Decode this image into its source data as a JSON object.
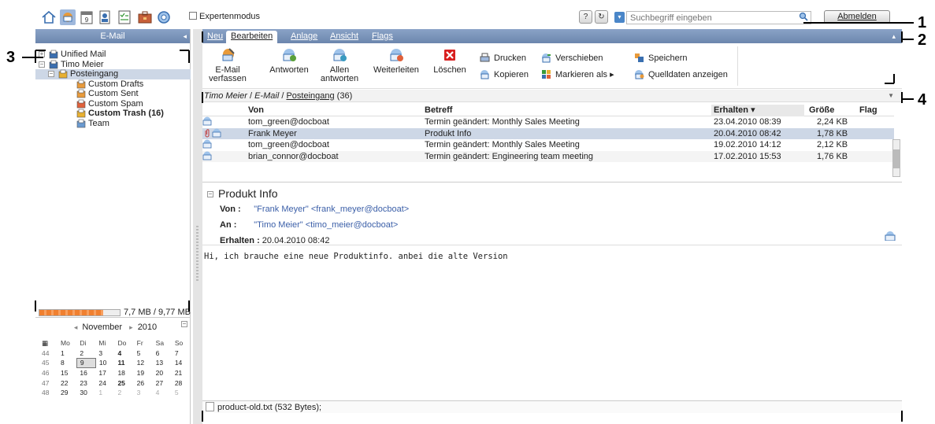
{
  "toolbar": {
    "apps": [
      "home-icon",
      "mail-icon",
      "calendar-icon",
      "contacts-icon",
      "tasks-icon",
      "infostore-icon",
      "settings-icon"
    ],
    "expert_mode_label": "Expertenmodus",
    "help_label": "?",
    "refresh_label": "↻",
    "search_placeholder": "Suchbegriff eingeben",
    "logout_label": "Abmelden"
  },
  "left_panel": {
    "title": "E-Mail",
    "tree": [
      {
        "label": "Unified Mail",
        "level": 0,
        "expander": "+",
        "icon": "unified-mail-icon"
      },
      {
        "label": "Timo Meier",
        "level": 0,
        "expander": "−",
        "icon": "account-icon"
      },
      {
        "label": "Posteingang",
        "level": 1,
        "expander": "−",
        "icon": "inbox-icon",
        "selected": true
      },
      {
        "label": "Custom Drafts",
        "level": 2,
        "expander": "",
        "icon": "drafts-icon"
      },
      {
        "label": "Custom Sent",
        "level": 2,
        "expander": "",
        "icon": "sent-icon"
      },
      {
        "label": "Custom Spam",
        "level": 2,
        "expander": "",
        "icon": "spam-icon"
      },
      {
        "label": "Custom Trash (16)",
        "level": 2,
        "expander": "",
        "icon": "trash-icon",
        "bold": true
      },
      {
        "label": "Team",
        "level": 2,
        "expander": "",
        "icon": "folder-icon"
      }
    ],
    "quota": {
      "text": "7,7 MB / 9,77 MB",
      "fraction": 0.79
    }
  },
  "calendar": {
    "month": "November",
    "year": "2010",
    "prev": "◂",
    "next": "▸",
    "headers": [
      "Mo",
      "Di",
      "Mi",
      "Do",
      "Fr",
      "Sa",
      "So"
    ],
    "weeks": [
      {
        "wk": "44",
        "days": [
          "1",
          "2",
          "3",
          "4",
          "5",
          "6",
          "7"
        ]
      },
      {
        "wk": "45",
        "days": [
          "8",
          "9",
          "10",
          "11",
          "12",
          "13",
          "14"
        ]
      },
      {
        "wk": "46",
        "days": [
          "15",
          "16",
          "17",
          "18",
          "19",
          "20",
          "21"
        ]
      },
      {
        "wk": "47",
        "days": [
          "22",
          "23",
          "24",
          "25",
          "26",
          "27",
          "28"
        ]
      },
      {
        "wk": "48",
        "days": [
          "29",
          "30",
          "1",
          "2",
          "3",
          "4",
          "5"
        ]
      }
    ],
    "current_day": "9"
  },
  "tabs": [
    {
      "label": "Neu",
      "active": false
    },
    {
      "label": "Bearbeiten",
      "active": true
    },
    {
      "label": "Anlage",
      "active": false
    },
    {
      "label": "Ansicht",
      "active": false
    },
    {
      "label": "Flags",
      "active": false
    }
  ],
  "ribbon": {
    "compose": "E-Mail verfassen",
    "reply": "Antworten",
    "reply_all": "Allen antworten",
    "forward": "Weiterleiten",
    "delete": "Löschen",
    "print": "Drucken",
    "copy": "Kopieren",
    "move": "Verschieben",
    "mark_as": "Markieren als ▸",
    "save": "Speichern",
    "show_source": "Quelldaten anzeigen"
  },
  "breadcrumb": {
    "user": "Timo Meier",
    "section": "E-Mail",
    "folder": "Posteingang",
    "count": "(36)"
  },
  "mail_table": {
    "columns": {
      "from": "Von",
      "subject": "Betreff",
      "received": "Erhalten ▾",
      "size": "Größe",
      "flag": "Flag"
    },
    "rows": [
      {
        "from": "tom_green@docboat",
        "subject": "Termin geändert: Monthly Sales Meeting",
        "received": "23.04.2010 08:39",
        "size": "2,24 KB",
        "attach": false,
        "selected": false
      },
      {
        "from": "Frank Meyer",
        "subject": "Produkt Info",
        "received": "20.04.2010 08:42",
        "size": "1,78 KB",
        "attach": true,
        "selected": true
      },
      {
        "from": "tom_green@docboat",
        "subject": "Termin geändert: Monthly Sales Meeting",
        "received": "19.02.2010 14:12",
        "size": "2,12 KB",
        "attach": false,
        "selected": false
      },
      {
        "from": "brian_connor@docboat",
        "subject": "Termin geändert: Engineering team meeting",
        "received": "17.02.2010 15:53",
        "size": "1,76 KB",
        "attach": false,
        "selected": false
      }
    ]
  },
  "preview": {
    "subject": "Produkt Info",
    "from_label": "Von :",
    "from_value": "\"Frank Meyer\" <frank_meyer@docboat>",
    "to_label": "An :",
    "to_value": "\"Timo Meier\" <timo_meier@docboat>",
    "received_label": "Erhalten :",
    "received_value": "20.04.2010 08:42",
    "body": "Hi, ich brauche eine neue Produktinfo. anbei die alte Version",
    "attachment": "product-old.txt (532 Bytes);"
  },
  "callouts": [
    "1",
    "2",
    "3",
    "4"
  ]
}
